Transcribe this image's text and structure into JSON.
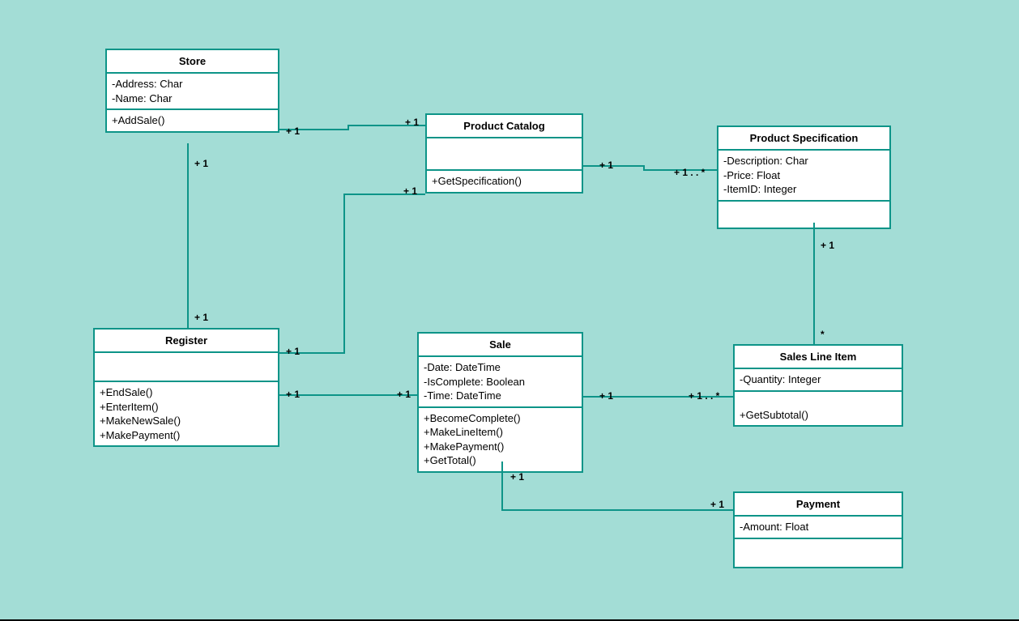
{
  "diagram_type": "UML Class Diagram",
  "classes": {
    "store": {
      "name": "Store",
      "attributes": [
        "-Address: Char",
        "-Name: Char"
      ],
      "methods": [
        "+AddSale()"
      ]
    },
    "productCatalog": {
      "name": "Product Catalog",
      "attributes": [],
      "methods": [
        "+GetSpecification()"
      ]
    },
    "productSpec": {
      "name": "Product Specification",
      "attributes": [
        "-Description: Char",
        "-Price: Float",
        "-ItemID: Integer"
      ],
      "methods": []
    },
    "register": {
      "name": "Register",
      "attributes": [],
      "methods": [
        "+EndSale()",
        "+EnterItem()",
        "+MakeNewSale()",
        "+MakePayment()"
      ]
    },
    "sale": {
      "name": "Sale",
      "attributes": [
        "-Date: DateTime",
        "-IsComplete: Boolean",
        "-Time: DateTime"
      ],
      "methods": [
        "+BecomeComplete()",
        "+MakeLineItem()",
        "+MakePayment()",
        "+GetTotal()"
      ]
    },
    "salesLineItem": {
      "name": "Sales Line Item",
      "attributes": [
        "-Quantity: Integer"
      ],
      "methods": [
        "+GetSubtotal()"
      ]
    },
    "payment": {
      "name": "Payment",
      "attributes": [
        "-Amount: Float"
      ],
      "methods": []
    }
  },
  "mult": {
    "store_catalog_left": "+ 1",
    "store_catalog_right": "+ 1",
    "store_register_top": "+ 1",
    "store_register_bottom": "+ 1",
    "register_catalog_left": "+ 1",
    "register_catalog_right": "+ 1",
    "register_sale_left": "+ 1",
    "register_sale_right": "+ 1",
    "catalog_spec_left": "+ 1",
    "catalog_spec_right": "+ 1 . . *",
    "spec_sli_top": "+ 1",
    "spec_sli_bottom": "*",
    "sale_sli_left": "+ 1",
    "sale_sli_right": "+ 1 . . *",
    "sale_payment_top": "+ 1",
    "sale_payment_right": "+ 1"
  }
}
